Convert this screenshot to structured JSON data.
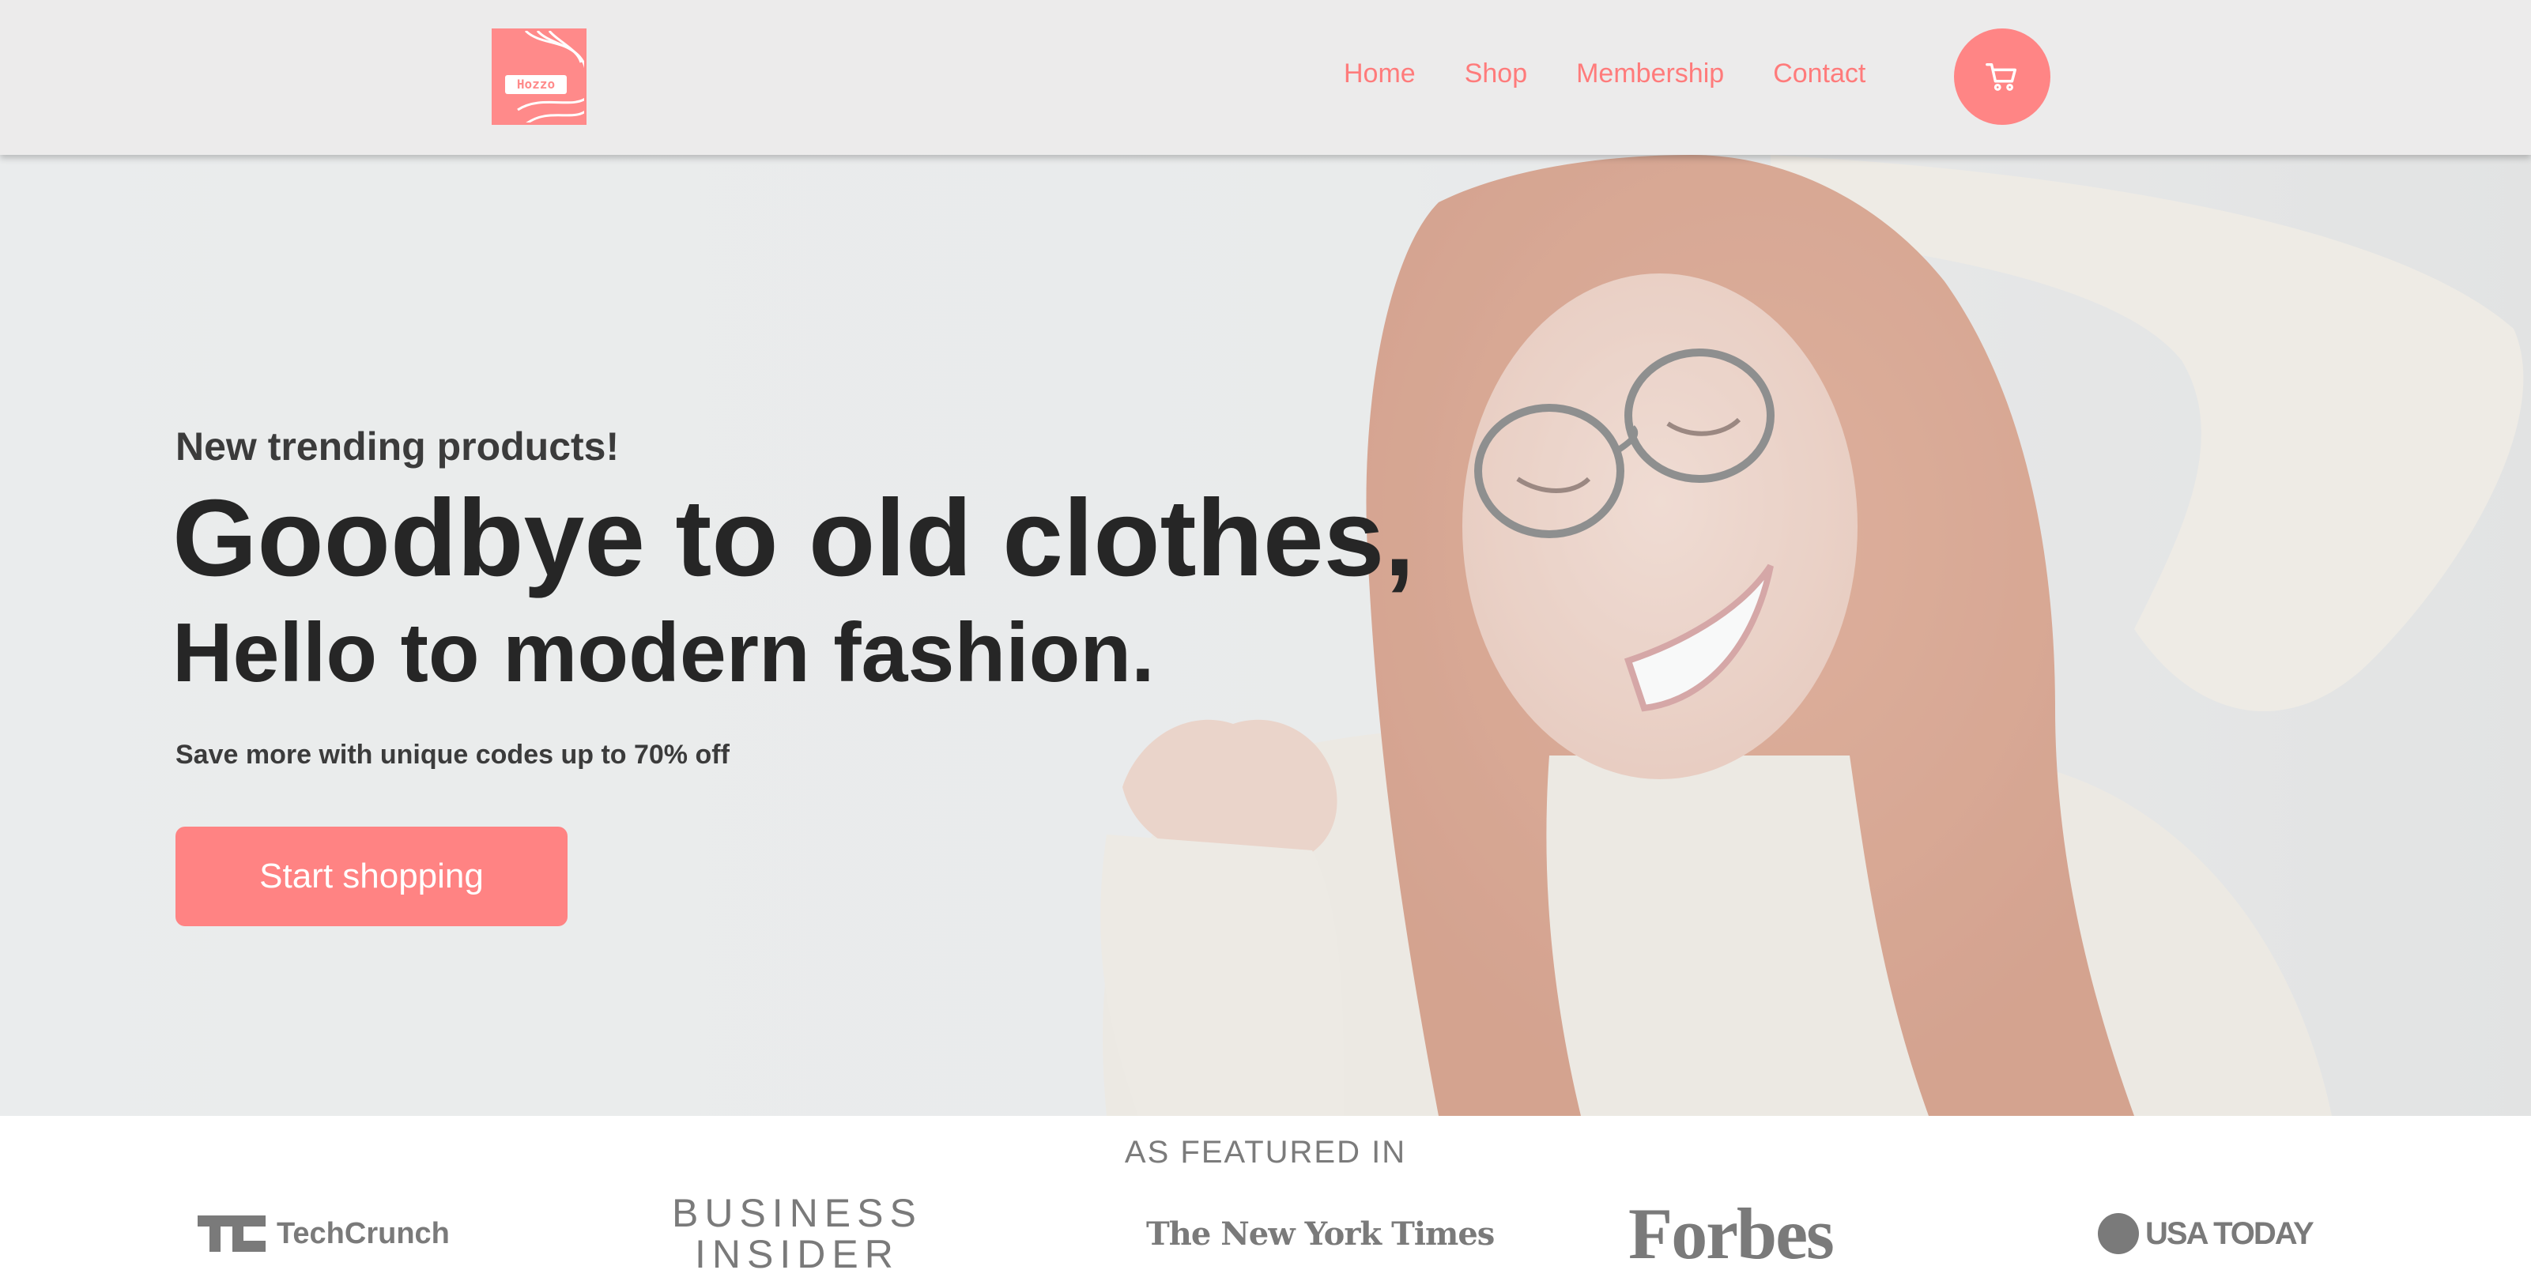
{
  "brand": {
    "logo_text": "Hozzo",
    "accent_color": "#ff8585"
  },
  "nav": {
    "links": [
      "Home",
      "Shop",
      "Membership",
      "Contact"
    ],
    "cart_icon": "cart-icon"
  },
  "hero": {
    "kicker": "New trending products!",
    "title_line_1": "Goodbye to old clothes,",
    "title_line_2": "Hello to modern fashion.",
    "subtitle": "Save more with unique codes up to 70% off",
    "cta_label": "Start shopping",
    "image": "smiling-woman-red-hair-glasses-sweater-photo"
  },
  "featured": {
    "heading": "AS FEATURED IN",
    "logos": {
      "techcrunch": {
        "mark": "TC",
        "text": "TechCrunch"
      },
      "business_insider": {
        "line1": "BUSINESS",
        "line2": "INSIDER"
      },
      "nyt": {
        "text": "The New York Times"
      },
      "forbes": {
        "text": "Forbes"
      },
      "usa_today": {
        "text": "USA TODAY"
      }
    }
  }
}
